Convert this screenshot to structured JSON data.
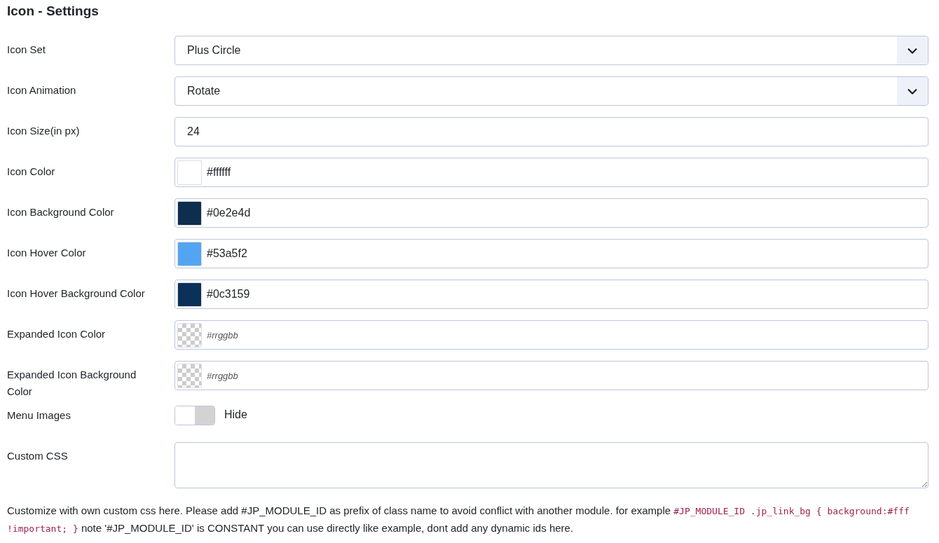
{
  "title": "Icon - Settings",
  "fields": [
    {
      "kind": "select",
      "label": "Icon Set",
      "value": "Plus Circle"
    },
    {
      "kind": "select",
      "label": "Icon Animation",
      "value": "Rotate"
    },
    {
      "kind": "text",
      "label": "Icon Size(in px)",
      "value": "24"
    },
    {
      "kind": "color",
      "label": "Icon Color",
      "value": "#ffffff",
      "color": "#ffffff"
    },
    {
      "kind": "color",
      "label": "Icon Background Color",
      "value": "#0e2e4d",
      "color": "#0e2e4d"
    },
    {
      "kind": "color",
      "label": "Icon Hover Color",
      "value": "#53a5f2",
      "color": "#53a5f2"
    },
    {
      "kind": "color",
      "label": "Icon Hover Background Color",
      "value": "#0c3159",
      "color": "#0c3159"
    },
    {
      "kind": "color",
      "label": "Expanded Icon Color",
      "placeholder": "#rrggbb"
    },
    {
      "kind": "color",
      "label": "Expanded Icon Background Color",
      "placeholder": "#rrggbb"
    },
    {
      "kind": "toggle",
      "label": "Menu Images",
      "on": false,
      "state_label": "Hide"
    },
    {
      "kind": "textarea",
      "label": "Custom CSS"
    }
  ],
  "help": [
    {
      "kind": "text",
      "text": "Customize with own custom css here. Please add #JP_MODULE_ID as prefix of class name to avoid conflict with another module. for example "
    },
    {
      "kind": "code",
      "text": "#JP_MODULE_ID .jp_link_bg { background:#fff !important; }"
    },
    {
      "kind": "text",
      "text": " note '#JP_MODULE_ID' is CONSTANT you can use directly like example, dont add any dynamic ids here."
    }
  ]
}
